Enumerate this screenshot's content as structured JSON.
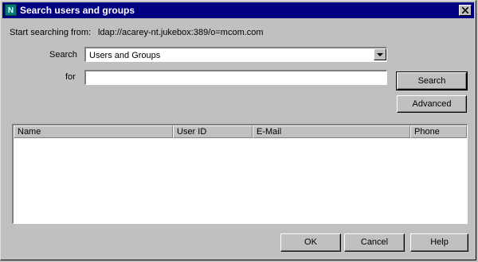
{
  "window": {
    "title": "Search users and groups",
    "app_icon_letter": "N"
  },
  "start": {
    "label": "Start searching from:",
    "value": "ldap://acarey-nt.jukebox:389/o=mcom.com"
  },
  "search": {
    "label": "Search",
    "selected": "Users and Groups"
  },
  "for": {
    "label": "for",
    "value": ""
  },
  "buttons": {
    "search": "Search",
    "advanced": "Advanced",
    "ok": "OK",
    "cancel": "Cancel",
    "help": "Help"
  },
  "results": {
    "columns": [
      "Name",
      "User ID",
      "E-Mail",
      "Phone"
    ],
    "rows": []
  }
}
